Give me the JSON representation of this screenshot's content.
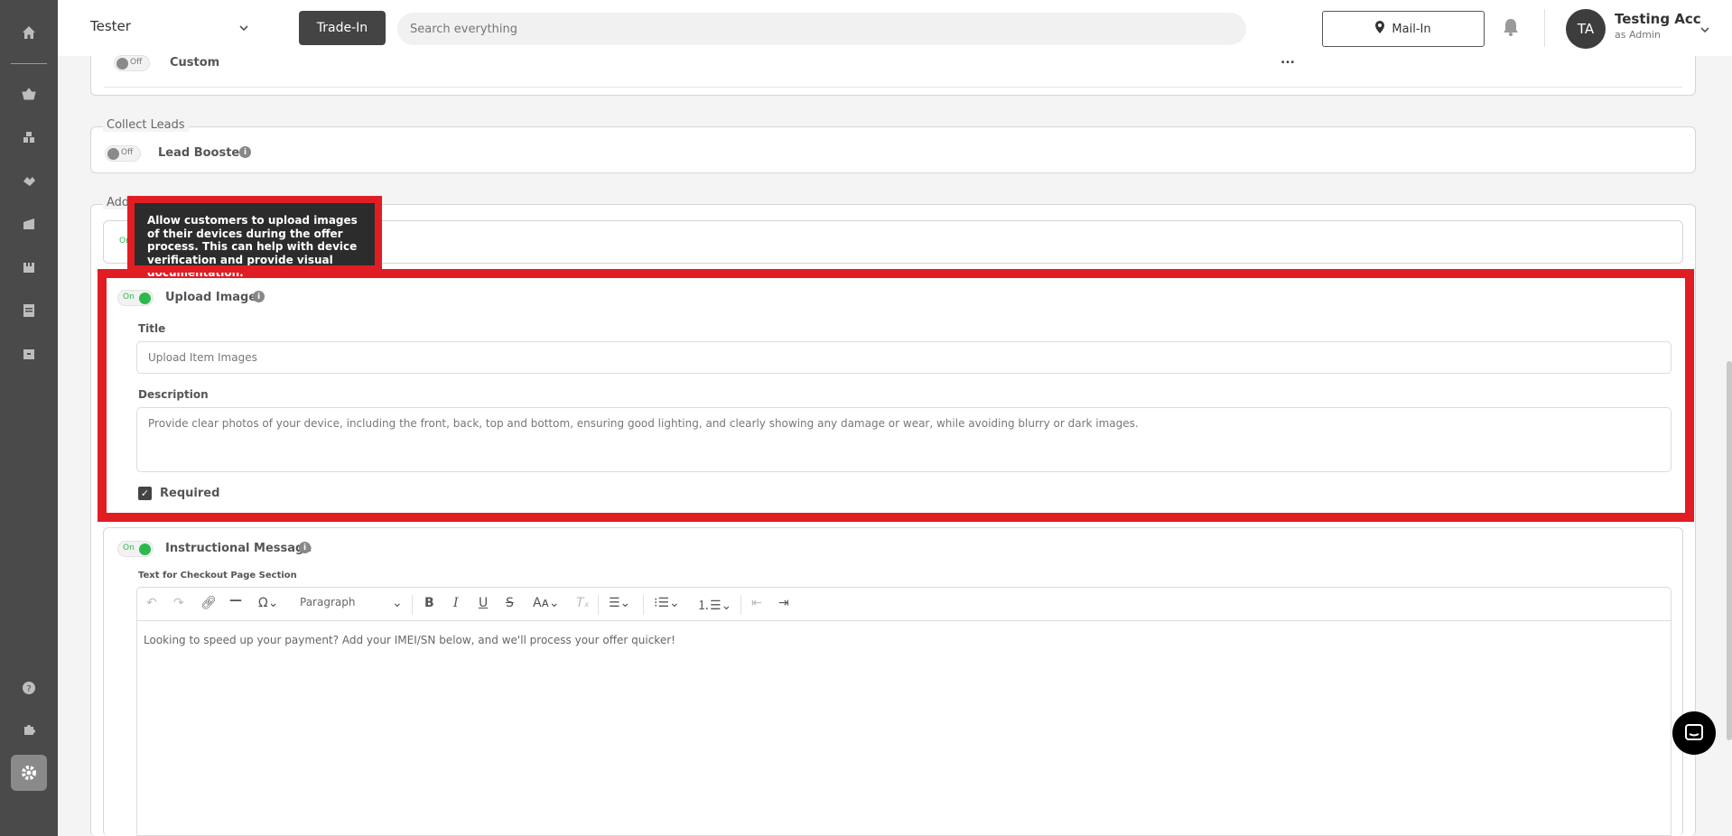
{
  "header": {
    "tenant": "Tester",
    "trade_in_label": "Trade-In",
    "search_placeholder": "Search everything",
    "mail_in_label": "Mail-In",
    "user_initials": "TA",
    "user_name": "Testing Acc",
    "user_role": "as Admin"
  },
  "custom_section": {
    "toggle_state": "Off",
    "label": "Custom",
    "more": "..."
  },
  "collect_leads": {
    "legend": "Collect Leads",
    "toggle_state": "Off",
    "label": "Lead Booster"
  },
  "additional": {
    "legend": "Addi",
    "first_toggle_state": "On"
  },
  "tooltip": {
    "text": "Allow customers to upload images of their devices during the offer process. This can help with device verification and provide visual documentation."
  },
  "upload_image": {
    "toggle_state": "On",
    "label": "Upload Image",
    "title_label": "Title",
    "title_value": "Upload Item Images",
    "description_label": "Description",
    "description_value": "Provide clear photos of your device, including the front, back, top and bottom, ensuring good lighting, and clearly showing any damage or wear, while avoiding blurry or dark images.",
    "required_label": "Required"
  },
  "instructional": {
    "toggle_state": "On",
    "label": "Instructional Message",
    "section_label": "Text for Checkout Page Section",
    "paragraph_label": "Paragraph",
    "editor_text": "Looking to speed up your payment? Add your IMEI/SN below, and we'll process your offer quicker!"
  },
  "colors": {
    "highlight": "#e11d24",
    "toggle_on": "#2db84d",
    "sidebar": "#4a4a4a"
  }
}
